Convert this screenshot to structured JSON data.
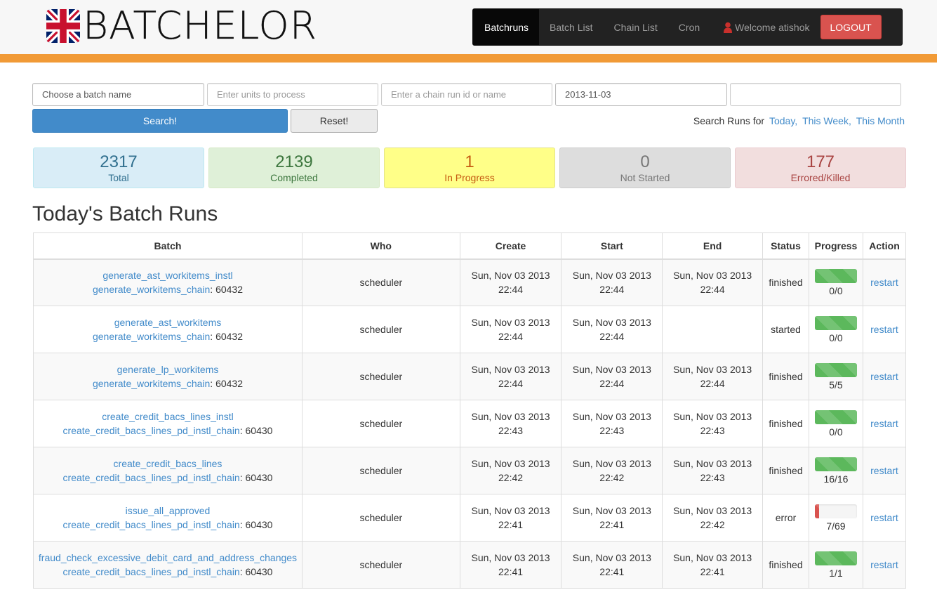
{
  "header": {
    "logo_text": "BATCHELOR",
    "accent_color": "#f19a36"
  },
  "nav": {
    "items": [
      {
        "label": "Batchruns",
        "active": true
      },
      {
        "label": "Batch List",
        "active": false
      },
      {
        "label": "Chain List",
        "active": false
      },
      {
        "label": "Cron",
        "active": false
      }
    ],
    "welcome": "Welcome atishok",
    "logout_label": "LOGOUT"
  },
  "search": {
    "batch_placeholder": "Choose a batch name",
    "units_placeholder": "Enter units to process",
    "chain_placeholder": "Enter a chain run id or name",
    "date_value": "2013-11-03",
    "extra_value": "",
    "search_label": "Search!",
    "reset_label": "Reset!",
    "runs_prefix": "Search Runs for",
    "runs_today": "Today,",
    "runs_week": "This Week,",
    "runs_month": "This Month"
  },
  "stats": {
    "total": {
      "value": "2317",
      "label": "Total"
    },
    "completed": {
      "value": "2139",
      "label": "Completed"
    },
    "in_progress": {
      "value": "1",
      "label": "In Progress"
    },
    "not_started": {
      "value": "0",
      "label": "Not Started"
    },
    "errored": {
      "value": "177",
      "label": "Errored/Killed"
    }
  },
  "page_title": "Today's Batch Runs",
  "table": {
    "headers": [
      "Batch",
      "Who",
      "Create",
      "Start",
      "End",
      "Status",
      "Progress",
      "Action"
    ],
    "rows": [
      {
        "batch": "generate_ast_workitems_instl",
        "chain": "generate_workitems_chain",
        "chain_id": ": 60432",
        "who": "scheduler",
        "create_date": "Sun, Nov 03 2013",
        "create_time": "22:44",
        "start_date": "Sun, Nov 03 2013",
        "start_time": "22:44",
        "end_date": "Sun, Nov 03 2013",
        "end_time": "22:44",
        "status": "finished",
        "progress": "0/0",
        "progress_fraction": 1.0,
        "progress_state": "success",
        "action": "restart"
      },
      {
        "batch": "generate_ast_workitems",
        "chain": "generate_workitems_chain",
        "chain_id": ": 60432",
        "who": "scheduler",
        "create_date": "Sun, Nov 03 2013",
        "create_time": "22:44",
        "start_date": "Sun, Nov 03 2013",
        "start_time": "22:44",
        "end_date": "",
        "end_time": "",
        "status": "started",
        "progress": "0/0",
        "progress_fraction": 1.0,
        "progress_state": "success",
        "action": "restart"
      },
      {
        "batch": "generate_lp_workitems",
        "chain": "generate_workitems_chain",
        "chain_id": ": 60432",
        "who": "scheduler",
        "create_date": "Sun, Nov 03 2013",
        "create_time": "22:44",
        "start_date": "Sun, Nov 03 2013",
        "start_time": "22:44",
        "end_date": "Sun, Nov 03 2013",
        "end_time": "22:44",
        "status": "finished",
        "progress": "5/5",
        "progress_fraction": 1.0,
        "progress_state": "success",
        "action": "restart"
      },
      {
        "batch": "create_credit_bacs_lines_instl",
        "chain": "create_credit_bacs_lines_pd_instl_chain",
        "chain_id": ": 60430",
        "who": "scheduler",
        "create_date": "Sun, Nov 03 2013",
        "create_time": "22:43",
        "start_date": "Sun, Nov 03 2013",
        "start_time": "22:43",
        "end_date": "Sun, Nov 03 2013",
        "end_time": "22:43",
        "status": "finished",
        "progress": "0/0",
        "progress_fraction": 1.0,
        "progress_state": "success",
        "action": "restart"
      },
      {
        "batch": "create_credit_bacs_lines",
        "chain": "create_credit_bacs_lines_pd_instl_chain",
        "chain_id": ": 60430",
        "who": "scheduler",
        "create_date": "Sun, Nov 03 2013",
        "create_time": "22:42",
        "start_date": "Sun, Nov 03 2013",
        "start_time": "22:42",
        "end_date": "Sun, Nov 03 2013",
        "end_time": "22:43",
        "status": "finished",
        "progress": "16/16",
        "progress_fraction": 1.0,
        "progress_state": "success",
        "action": "restart"
      },
      {
        "batch": "issue_all_approved",
        "chain": "create_credit_bacs_lines_pd_instl_chain",
        "chain_id": ": 60430",
        "who": "scheduler",
        "create_date": "Sun, Nov 03 2013",
        "create_time": "22:41",
        "start_date": "Sun, Nov 03 2013",
        "start_time": "22:41",
        "end_date": "Sun, Nov 03 2013",
        "end_time": "22:42",
        "status": "error",
        "progress": "7/69",
        "progress_fraction": 0.1,
        "progress_state": "danger",
        "action": "restart"
      },
      {
        "batch": "fraud_check_excessive_debit_card_and_address_changes",
        "chain": "create_credit_bacs_lines_pd_instl_chain",
        "chain_id": ": 60430",
        "who": "scheduler",
        "create_date": "Sun, Nov 03 2013",
        "create_time": "22:41",
        "start_date": "Sun, Nov 03 2013",
        "start_time": "22:41",
        "end_date": "Sun, Nov 03 2013",
        "end_time": "22:41",
        "status": "finished",
        "progress": "1/1",
        "progress_fraction": 1.0,
        "progress_state": "success",
        "action": "restart"
      }
    ]
  }
}
